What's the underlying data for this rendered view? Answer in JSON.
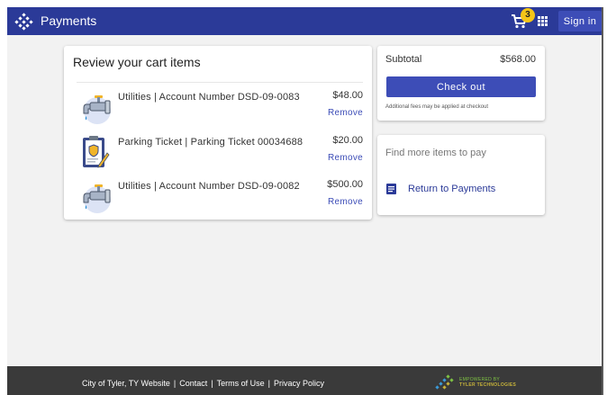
{
  "header": {
    "title": "Payments",
    "cart_count": "3",
    "signin_label": "Sign in"
  },
  "cart": {
    "title": "Review your cart items",
    "items": [
      {
        "name": "Utilities | Account Number DSD-09-0083",
        "price": "$48.00",
        "remove_label": "Remove",
        "icon": "faucet-icon"
      },
      {
        "name": "Parking Ticket | Parking Ticket 00034688",
        "price": "$20.00",
        "remove_label": "Remove",
        "icon": "clipboard-badge-icon"
      },
      {
        "name": "Utilities | Account Number DSD-09-0082",
        "price": "$500.00",
        "remove_label": "Remove",
        "icon": "faucet-icon"
      }
    ]
  },
  "summary": {
    "subtotal_label": "Subtotal",
    "subtotal_value": "$568.00",
    "checkout_label": "Check out",
    "fees_note": "Additional fees may be applied at checkout"
  },
  "more": {
    "title": "Find more items to pay",
    "return_label": "Return to Payments"
  },
  "footer": {
    "links": [
      "City of Tyler, TY Website",
      "Contact",
      "Terms of Use",
      "Privacy Policy"
    ],
    "brand_line1": "EMPOWERED BY",
    "brand_line2": "TYLER TECHNOLOGIES"
  },
  "colors": {
    "header_bg": "#2b3a98",
    "primary_button": "#3d4db7",
    "badge": "#f5c518",
    "footer_bg": "#3a3a3a"
  }
}
